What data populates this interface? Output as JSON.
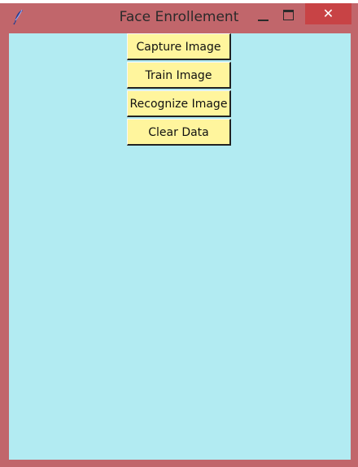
{
  "window": {
    "title": "Face Enrollement",
    "app_icon": "feather-icon",
    "controls": {
      "minimize_icon": "minimize-icon",
      "maximize_icon": "maximize-icon",
      "close_label": "✕"
    },
    "colors": {
      "frame": "#c1666b",
      "close_button": "#c84345",
      "client_background": "#b2ebf2",
      "button_background": "#fff59d"
    }
  },
  "buttons": [
    {
      "label": "Capture Image"
    },
    {
      "label": "Train Image"
    },
    {
      "label": "Recognize Image"
    },
    {
      "label": "Clear Data"
    }
  ]
}
